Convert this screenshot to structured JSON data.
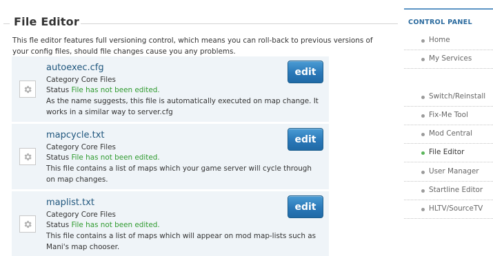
{
  "page": {
    "title": "File Editor",
    "intro": "This fle editor features full versioning control, which means you can roll-back to previous versions of your config files, should file changes cause you any problems."
  },
  "files": [
    {
      "name": "autoexec.cfg",
      "category_label": "Category",
      "category": "Core Files",
      "status_label": "Status",
      "status": "File has not been edited.",
      "description": "As the name suggests, this file is automatically executed on map change. It works in a similar way to server.cfg",
      "edit_label": "edit"
    },
    {
      "name": "mapcycle.txt",
      "category_label": "Category",
      "category": "Core Files",
      "status_label": "Status",
      "status": "File has not been edited.",
      "description": "This file contains a list of maps which your game server will cycle through on map changes.",
      "edit_label": "edit"
    },
    {
      "name": "maplist.txt",
      "category_label": "Category",
      "category": "Core Files",
      "status_label": "Status",
      "status": "File has not been edited.",
      "description": "This file contains a list of maps which will appear on mod map-lists such as Mani's map chooser.",
      "edit_label": "edit"
    }
  ],
  "sidebar": {
    "title": "CONTROL PANEL",
    "items": [
      {
        "label": "Home",
        "active": false
      },
      {
        "label": "My Services",
        "active": false
      },
      {
        "label": "Switch/Reinstall",
        "active": false
      },
      {
        "label": "Fix-Me Tool",
        "active": false
      },
      {
        "label": "Mod Central",
        "active": false
      },
      {
        "label": "File Editor",
        "active": true
      },
      {
        "label": "User Manager",
        "active": false
      },
      {
        "label": "Startline Editor",
        "active": false
      },
      {
        "label": "HLTV/SourceTV",
        "active": false
      }
    ]
  },
  "icons": {
    "file_icon": "gear-icon",
    "nav_bullet": "bullet-dot-icon"
  },
  "colors": {
    "link": "#1f567d",
    "status_ok": "#2e9a2e",
    "button": "#2a78b8",
    "sidebar_accent": "#2a6a9e",
    "active_bullet": "#5ab55a"
  }
}
